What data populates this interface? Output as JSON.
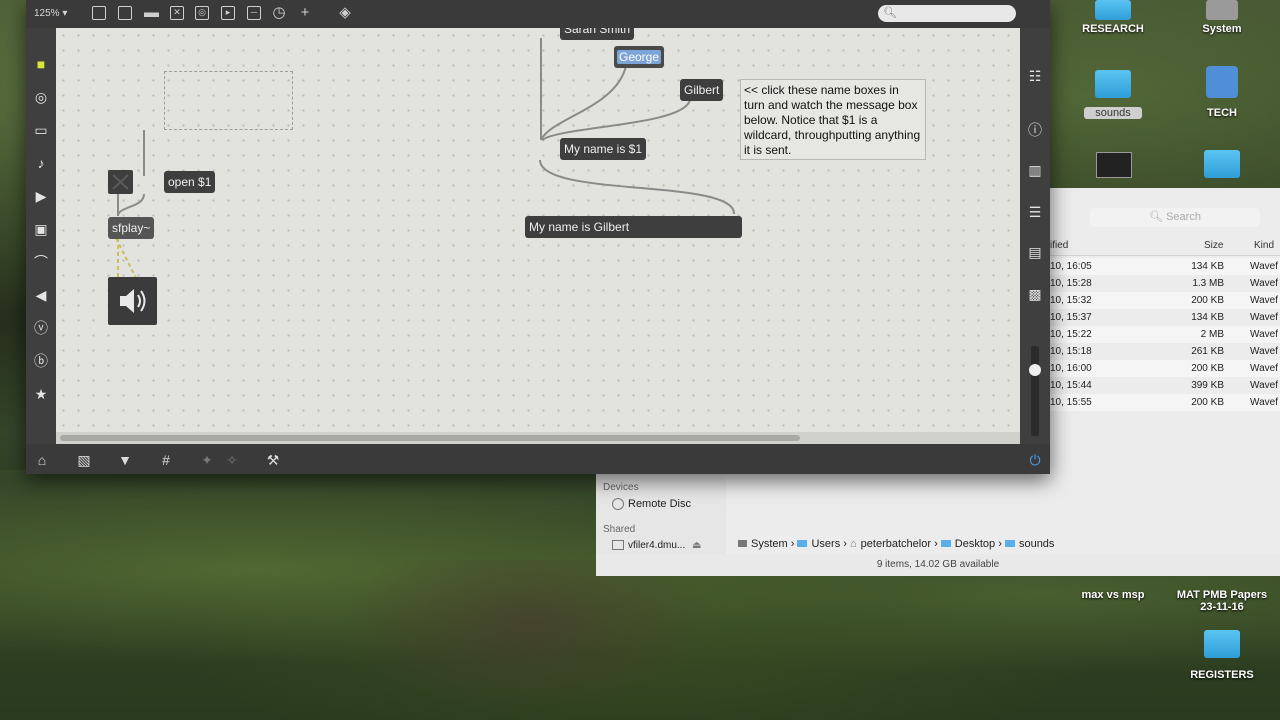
{
  "max": {
    "zoom": "125%",
    "objects": {
      "sarah": "Sarah Smith",
      "george": "George",
      "gilbert": "Gilbert",
      "my_name": "My name is $1",
      "output": "My name is Gilbert",
      "open": "open $1",
      "sfplay": "sfplay~"
    },
    "comment": "<< click these name boxes in turn and watch the message box below. Notice that $1 is a wildcard, throughputting anything it is sent."
  },
  "finder": {
    "search_placeholder": "Search",
    "columns": {
      "date": "ified",
      "size": "Size",
      "kind": "Kind"
    },
    "rows": [
      {
        "date": "10, 16:05",
        "size": "134 KB",
        "kind": "Wavef"
      },
      {
        "date": "10, 15:28",
        "size": "1.3 MB",
        "kind": "Wavef"
      },
      {
        "date": "10, 15:32",
        "size": "200 KB",
        "kind": "Wavef"
      },
      {
        "date": "10, 15:37",
        "size": "134 KB",
        "kind": "Wavef"
      },
      {
        "date": "10, 15:22",
        "size": "2 MB",
        "kind": "Wavef"
      },
      {
        "date": "10, 15:18",
        "size": "261 KB",
        "kind": "Wavef"
      },
      {
        "date": "10, 16:00",
        "size": "200 KB",
        "kind": "Wavef"
      },
      {
        "date": "10, 15:44",
        "size": "399 KB",
        "kind": "Wavef"
      },
      {
        "date": "10, 15:55",
        "size": "200 KB",
        "kind": "Wavef"
      }
    ],
    "sidebar": {
      "devices": "Devices",
      "remote_disc": "Remote Disc",
      "shared": "Shared",
      "shared_item": "vfiler4.dmu..."
    },
    "path": [
      "System",
      "Users",
      "peterbatchelor",
      "Desktop",
      "sounds"
    ],
    "status": "9 items, 14.02 GB available"
  },
  "desktop": {
    "research": "RESEARCH",
    "system": "System",
    "sounds": "sounds",
    "tech": "TECH",
    "max_vs_msp": "max vs msp",
    "mat_pmb_1": "MAT PMB Papers",
    "mat_pmb_2": "23-11-16",
    "registers": "REGISTERS"
  }
}
